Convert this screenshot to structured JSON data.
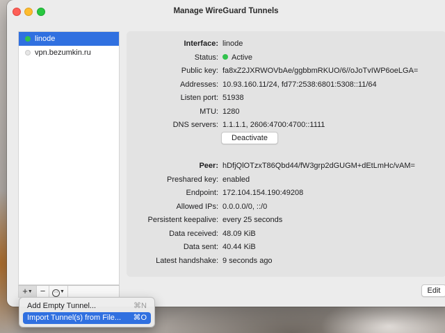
{
  "window": {
    "title": "Manage WireGuard Tunnels"
  },
  "sidebar": {
    "tunnels": [
      {
        "name": "linode",
        "status": "active",
        "selected": true
      },
      {
        "name": "vpn.bezumkin.ru",
        "status": "inactive",
        "selected": false
      }
    ],
    "toolbar": {
      "add_icon": "+",
      "remove_icon": "−",
      "more_icon": "⋯"
    }
  },
  "interface": {
    "heading": "Interface:",
    "name": "linode",
    "status_label": "Status:",
    "status_value": "Active",
    "public_key_label": "Public key:",
    "public_key": "fa8xZ2JXRWOVbAe/ggbbmRKUO/6//oJoTvIWP6oeLGA=",
    "addresses_label": "Addresses:",
    "addresses": "10.93.160.11/24, fd77:2538:6801:5308::11/64",
    "listen_port_label": "Listen port:",
    "listen_port": "51938",
    "mtu_label": "MTU:",
    "mtu": "1280",
    "dns_label": "DNS servers:",
    "dns": "1.1.1.1, 2606:4700:4700::1111",
    "deactivate_label": "Deactivate"
  },
  "peer": {
    "heading": "Peer:",
    "public_key": "hDfjQlOTzxT86Qbd44/fW3grp2dGUGM+dEtLmHc/vAM=",
    "preshared_label": "Preshared key:",
    "preshared": "enabled",
    "endpoint_label": "Endpoint:",
    "endpoint": "172.104.154.190:49208",
    "allowed_ips_label": "Allowed IPs:",
    "allowed_ips": "0.0.0.0/0, ::/0",
    "keepalive_label": "Persistent keepalive:",
    "keepalive": "every 25 seconds",
    "received_label": "Data received:",
    "received": "48.09 KiB",
    "sent_label": "Data sent:",
    "sent": "40.44 KiB",
    "handshake_label": "Latest handshake:",
    "handshake": "9 seconds ago"
  },
  "actions": {
    "edit_label": "Edit"
  },
  "add_menu": {
    "items": [
      {
        "label": "Add Empty Tunnel...",
        "shortcut": "⌘N"
      },
      {
        "label": "Import Tunnel(s) from File...",
        "shortcut": "⌘O"
      }
    ]
  }
}
